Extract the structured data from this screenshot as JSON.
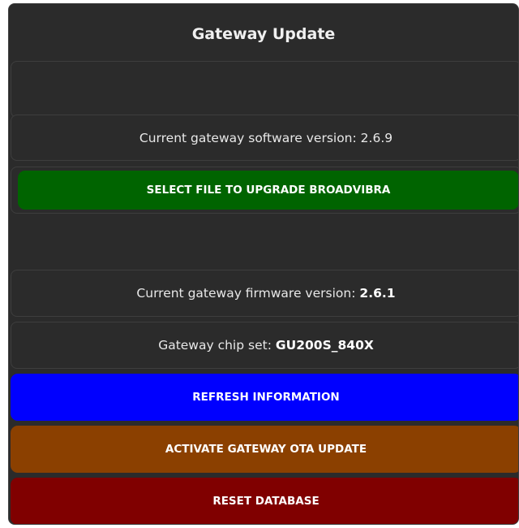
{
  "title": "Gateway Update",
  "software": {
    "label": "Current gateway software version:",
    "value": "2.6.9"
  },
  "select_file_button": "SELECT FILE TO UPGRADE BROADVIBRA",
  "firmware": {
    "label": "Current gateway firmware version:",
    "value": "2.6.1"
  },
  "chipset": {
    "label": "Gateway chip set:",
    "value": "GU200S_840X"
  },
  "buttons": {
    "refresh": "REFRESH INFORMATION",
    "ota": "ACTIVATE GATEWAY OTA UPDATE",
    "reset": "RESET DATABASE"
  },
  "colors": {
    "panel_bg": "#2b2b2b",
    "select_file": "#006400",
    "refresh": "#0000ff",
    "ota": "#8b4000",
    "reset": "#800000"
  }
}
